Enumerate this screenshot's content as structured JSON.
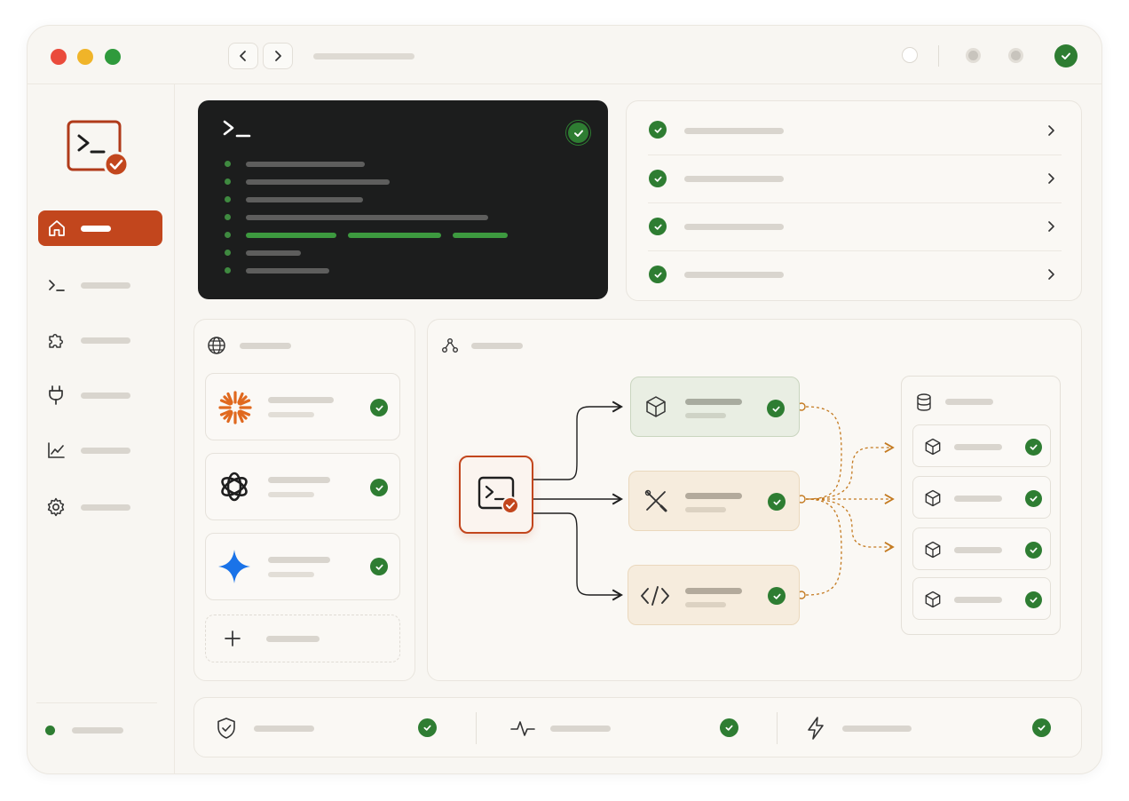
{
  "window": {
    "traffic_lights": [
      "#ea4b3c",
      "#f0b429",
      "#2f9a3c"
    ],
    "accent": "#c2461d",
    "success": "#2e7d32"
  },
  "titlebar": {
    "back_icon": "chevron-left-icon",
    "forward_icon": "chevron-right-icon",
    "status_icon": "check-circle-icon"
  },
  "sidebar": {
    "logo_icon": "terminal-check-icon",
    "items": [
      {
        "icon": "home-icon",
        "active": true
      },
      {
        "icon": "terminal-icon"
      },
      {
        "icon": "puzzle-icon"
      },
      {
        "icon": "plug-icon"
      },
      {
        "icon": "chart-icon"
      },
      {
        "icon": "gear-icon"
      }
    ],
    "status_color": "#2e7d32"
  },
  "terminal": {
    "prompt": ">_",
    "status_icon": "check-circle-icon"
  },
  "checklist": {
    "rows": 4,
    "row_icon": "check-circle-icon",
    "chevron_icon": "chevron-right-icon"
  },
  "providers": {
    "header_icon": "globe-icon",
    "items": [
      {
        "icon": "sunburst-icon",
        "color": "#e0691f"
      },
      {
        "icon": "openai-knot-icon",
        "color": "#1f1f1f"
      },
      {
        "icon": "sparkle-star-icon",
        "color": "#1a73e8"
      }
    ],
    "add_icon": "plus-icon"
  },
  "workflow": {
    "header_icon": "nodes-icon",
    "source_icon": "terminal-check-icon",
    "nodes": [
      {
        "icon": "cube-icon",
        "bg": "#e9eee3",
        "border": "#c9d5bf"
      },
      {
        "icon": "tools-icon",
        "bg": "#f6ecdd",
        "border": "#ead8bd"
      },
      {
        "icon": "code-icon",
        "bg": "#f6ecdd",
        "border": "#ead8bd"
      }
    ],
    "connector_color": "#c47a20"
  },
  "resources": {
    "header_icon": "database-icon",
    "items": 4,
    "item_icon": "cube-icon"
  },
  "statusbar": {
    "items": [
      {
        "icon": "shield-check-icon"
      },
      {
        "icon": "pulse-icon"
      },
      {
        "icon": "lightning-icon"
      }
    ]
  }
}
